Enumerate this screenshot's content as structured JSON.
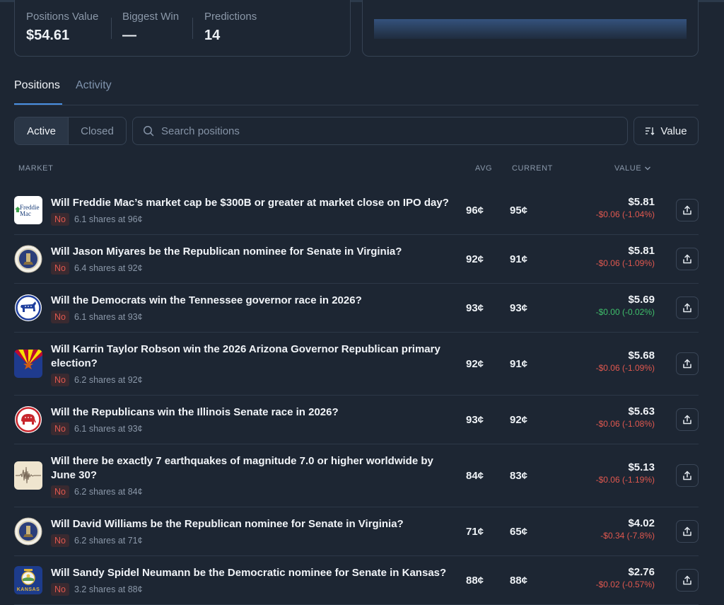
{
  "stats": {
    "positions_value_label": "Positions Value",
    "positions_value": "$54.61",
    "biggest_win_label": "Biggest Win",
    "biggest_win": "—",
    "predictions_label": "Predictions",
    "predictions": "14"
  },
  "tabs": [
    {
      "label": "Positions",
      "active": true
    },
    {
      "label": "Activity",
      "active": false
    }
  ],
  "filter": {
    "active_label": "Active",
    "closed_label": "Closed",
    "search_placeholder": "Search positions",
    "sort_label": "Value"
  },
  "columns": {
    "market": "MARKET",
    "avg": "AVG",
    "current": "CURRENT",
    "value": "VALUE"
  },
  "colors": {
    "accent": "#4a90e2",
    "negative": "#e0584f",
    "positive": "#3fbf6b"
  },
  "positions": [
    {
      "title": "Will Freddie Mac’s market cap be $300B or greater at market close on IPO day?",
      "outcome": "No",
      "shares": "6.1 shares at 96¢",
      "avg": "96¢",
      "current": "95¢",
      "value": "$5.81",
      "change": "-$0.06 (-1.04%)",
      "icon": "freddie-mac-logo-icon",
      "icon_text": "Freddie Mac"
    },
    {
      "title": "Will Jason Miyares be the Republican nominee for Senate in Virginia?",
      "outcome": "No",
      "shares": "6.4 shares at 92¢",
      "avg": "92¢",
      "current": "91¢",
      "value": "$5.81",
      "change": "-$0.06 (-1.09%)",
      "icon": "virginia-seal-icon"
    },
    {
      "title": "Will the Democrats win the Tennessee governor race in 2026?",
      "outcome": "No",
      "shares": "6.1 shares at 93¢",
      "avg": "93¢",
      "current": "93¢",
      "value": "$5.69",
      "change": "-$0.00 (-0.02%)",
      "icon": "democrat-donkey-icon"
    },
    {
      "title": "Will Karrin Taylor Robson win the 2026 Arizona Governor Republican primary election?",
      "outcome": "No",
      "shares": "6.2 shares at 92¢",
      "avg": "92¢",
      "current": "91¢",
      "value": "$5.68",
      "change": "-$0.06 (-1.09%)",
      "icon": "arizona-flag-icon"
    },
    {
      "title": "Will the Republicans win the Illinois Senate race in 2026?",
      "outcome": "No",
      "shares": "6.1 shares at 93¢",
      "avg": "93¢",
      "current": "92¢",
      "value": "$5.63",
      "change": "-$0.06 (-1.08%)",
      "icon": "republican-elephant-icon"
    },
    {
      "title": "Will there be exactly 7 earthquakes of magnitude 7.0 or higher worldwide by June 30?",
      "outcome": "No",
      "shares": "6.2 shares at 84¢",
      "avg": "84¢",
      "current": "83¢",
      "value": "$5.13",
      "change": "-$0.06 (-1.19%)",
      "icon": "seismograph-icon"
    },
    {
      "title": "Will David Williams be the Republican nominee for Senate in Virginia?",
      "outcome": "No",
      "shares": "6.2 shares at 71¢",
      "avg": "71¢",
      "current": "65¢",
      "value": "$4.02",
      "change": "-$0.34 (-7.8%)",
      "icon": "virginia-seal-icon"
    },
    {
      "title": "Will Sandy Spidel Neumann be the Democratic nominee for Senate in Kansas?",
      "outcome": "No",
      "shares": "3.2 shares at 88¢",
      "avg": "88¢",
      "current": "88¢",
      "value": "$2.76",
      "change": "-$0.02 (-0.57%)",
      "icon": "kansas-flag-icon",
      "icon_text": "KANSAS"
    }
  ]
}
